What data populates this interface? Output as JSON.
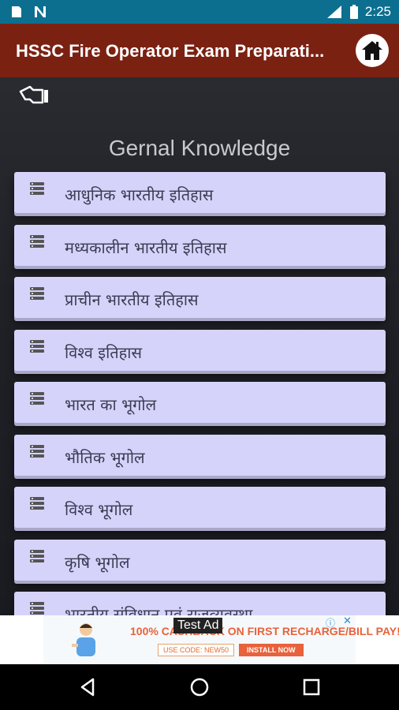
{
  "status_bar": {
    "time": "2:25",
    "icons": [
      "notes-icon",
      "n-notification-icon",
      "lte-signal-icon",
      "battery-icon"
    ]
  },
  "app_bar": {
    "title": "HSSC Fire Operator Exam Preparati...",
    "home_icon": "home-icon"
  },
  "toolbar": {
    "swipe_icon": "hand-pointer-icon"
  },
  "section_title": "Gernal Knowledge",
  "list": {
    "item_icon": "list-menu-icon",
    "items": [
      {
        "label": "आधुनिक भारतीय इतिहास"
      },
      {
        "label": "मध्यकालीन भारतीय इतिहास"
      },
      {
        "label": "प्राचीन भारतीय इतिहास"
      },
      {
        "label": "विश्व इतिहास"
      },
      {
        "label": "भारत का भूगोल"
      },
      {
        "label": "भौतिक भूगोल"
      },
      {
        "label": "विश्व भूगोल"
      },
      {
        "label": "कृषि भूगोल"
      },
      {
        "label": "भारतीय संविधान एवं राजव्यवस्था"
      }
    ]
  },
  "ad": {
    "test_label": "Test Ad",
    "headline": "100% CASHBACK ON FIRST RECHARGE/BILL PAY!",
    "code": "USE CODE: NEW50",
    "install": "INSTALL NOW",
    "accent_color": "#e8623b"
  },
  "nav_bar": {
    "buttons": [
      "back-icon",
      "home-circle-icon",
      "recents-icon"
    ]
  },
  "colors": {
    "status_bar": "#0d6f8f",
    "app_bar": "#7b2112",
    "list_item": "#d6d3fb",
    "background": "#1c1d22"
  }
}
